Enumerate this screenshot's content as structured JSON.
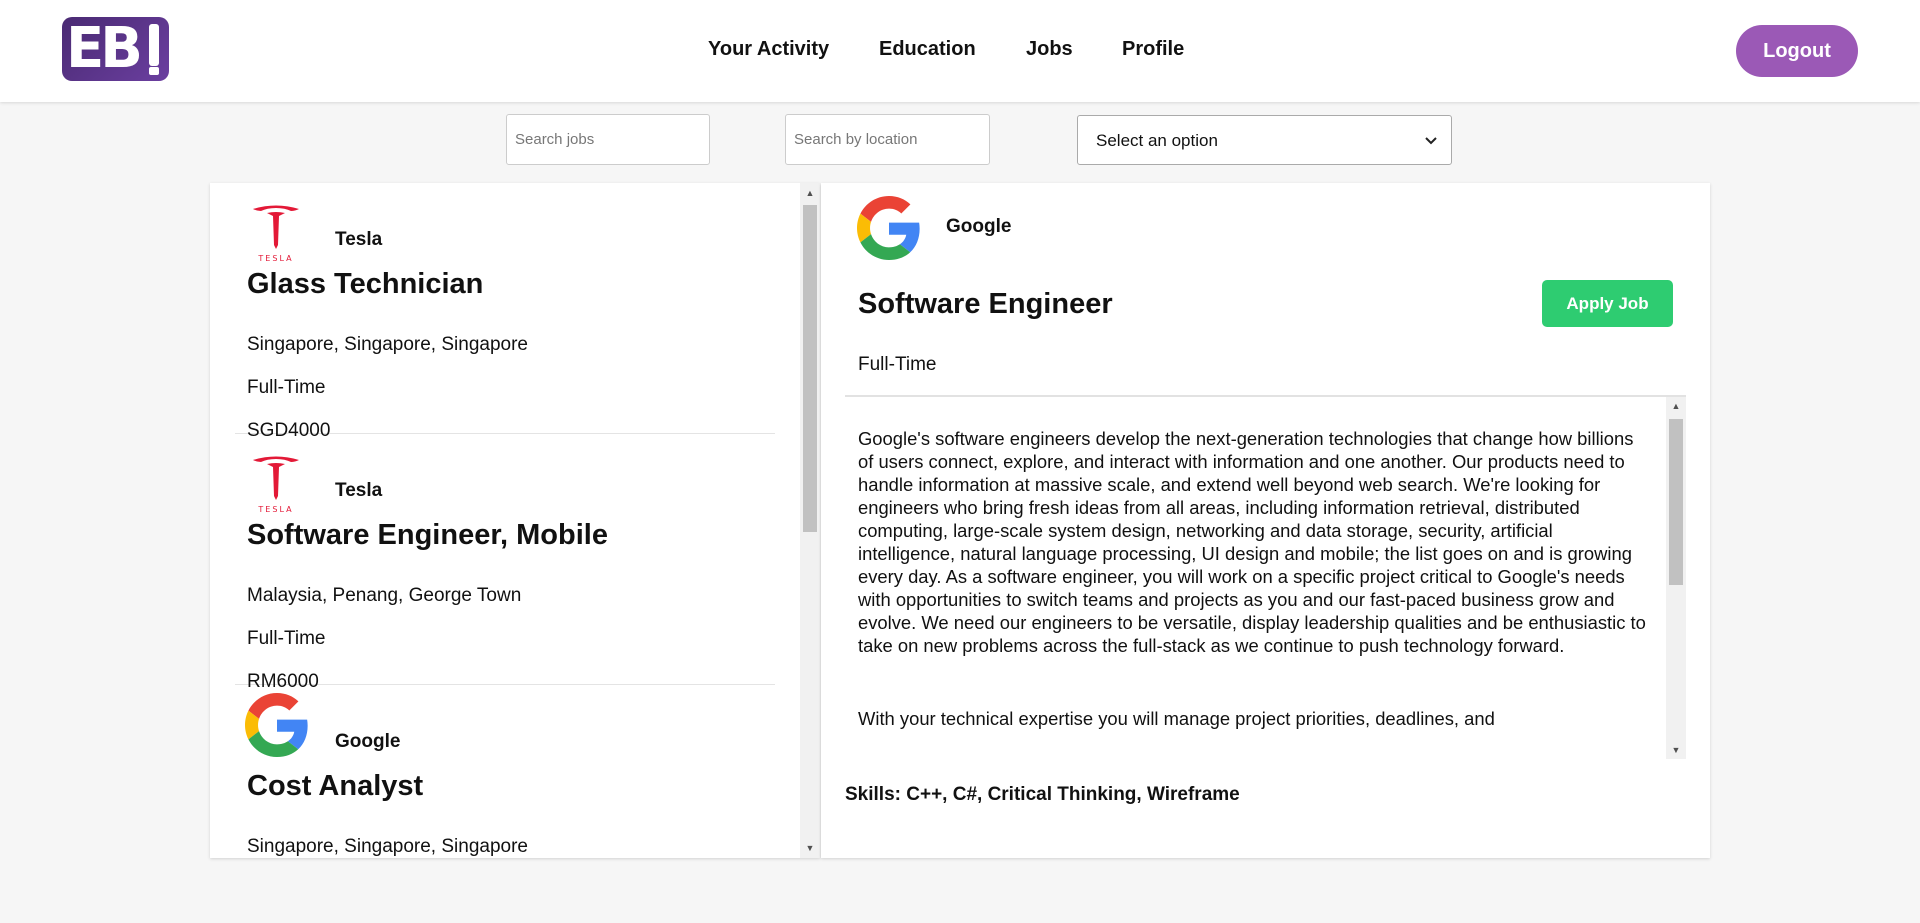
{
  "header": {
    "logo_text": "EB",
    "nav": [
      "Your Activity",
      "Education",
      "Jobs",
      "Profile"
    ],
    "logout_label": "Logout"
  },
  "search": {
    "jobs_placeholder": "Search jobs",
    "location_placeholder": "Search by location",
    "select_value": "Select an option"
  },
  "jobs": [
    {
      "company": "Tesla",
      "logo": "tesla-logo",
      "title": "Glass Technician",
      "location": "Singapore, Singapore, Singapore",
      "type": "Full-Time",
      "salary": "SGD4000"
    },
    {
      "company": "Tesla",
      "logo": "tesla-logo",
      "title": "Software Engineer, Mobile",
      "location": "Malaysia, Penang, George Town",
      "type": "Full-Time",
      "salary": "RM6000"
    },
    {
      "company": "Google",
      "logo": "google-logo",
      "title": "Cost Analyst",
      "location": "Singapore, Singapore, Singapore",
      "type": "",
      "salary": ""
    }
  ],
  "detail": {
    "company": "Google",
    "logo": "google-logo",
    "title": "Software Engineer",
    "apply_label": "Apply Job",
    "type": "Full-Time",
    "description": [
      "Google's software engineers develop the next-generation technologies that change how billions of users connect, explore, and interact with information and one another. Our products need to handle information at massive scale, and extend well beyond web search. We're looking for engineers who bring fresh ideas from all areas, including information retrieval, distributed computing, large-scale system design, networking and data storage, security, artificial intelligence, natural language processing, UI design and mobile; the list goes on and is growing every day. As a software engineer, you will work on a specific project critical to Google's needs with opportunities to switch teams and projects as you and our fast-paced business grow and evolve. We need our engineers to be versatile, display leadership qualities and be enthusiastic to take on new problems across the full-stack as we continue to push technology forward.",
      "With your technical expertise you will manage project priorities, deadlines, and"
    ],
    "skills": "Skills: C++, C#, Critical Thinking, Wireframe"
  },
  "colors": {
    "accent_purple": "#9b59b6",
    "logo_purple": "#5a3590",
    "apply_green": "#2ecc71",
    "tesla_red": "#e31937"
  }
}
